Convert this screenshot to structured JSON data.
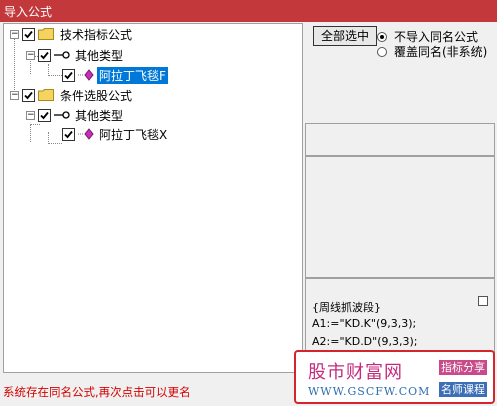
{
  "window": {
    "title": "导入公式"
  },
  "tree": {
    "nodes": [
      {
        "label": "技术指标公式",
        "level": 0,
        "checked": true
      },
      {
        "label": "其他类型",
        "level": 1,
        "checked": true
      },
      {
        "label": "阿拉丁飞毯F",
        "level": 2,
        "checked": true,
        "selected": true
      },
      {
        "label": "条件选股公式",
        "level": 0,
        "checked": true
      },
      {
        "label": "其他类型",
        "level": 1,
        "checked": true
      },
      {
        "label": "阿拉丁飞毯X",
        "level": 2,
        "checked": true,
        "selected": false
      }
    ]
  },
  "options": {
    "select_all_label": "全部选中",
    "radio_no_import": "不导入同名公式",
    "radio_overwrite": "覆盖同名(非系统)",
    "selected_radio": "radio_no_import"
  },
  "preview": {
    "lines": [
      "{周线抓波段}",
      "A1:=\"KD.K\"(9,3,3);",
      "A2:=\"KD.D\"(9,3,3);"
    ]
  },
  "status": {
    "message": "系统存在同名公式,再次点击可以更名"
  },
  "watermark": {
    "brand": "股市财富网",
    "url": "WWW.GSCFW.COM",
    "tag1": "指标分享",
    "tag2": "名师课程"
  },
  "colors": {
    "titlebar": "#c3393b",
    "selection": "#0078d7",
    "status_text": "#d40000"
  }
}
